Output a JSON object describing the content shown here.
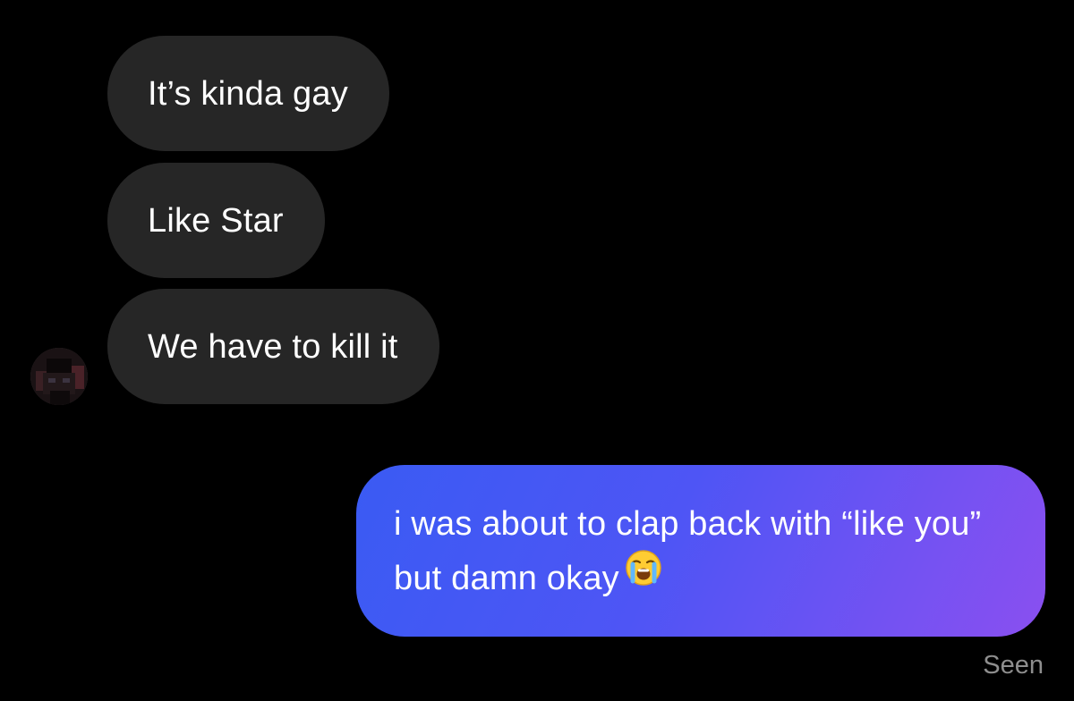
{
  "conversation": {
    "incoming_messages": [
      {
        "text": "It’s kinda gay"
      },
      {
        "text": "Like Star"
      },
      {
        "text": "We have to kill it"
      }
    ],
    "outgoing_message": {
      "text": "i was about to clap back with “like you” but damn okay",
      "emoji": "loudly-crying-face-icon"
    },
    "status": "Seen"
  },
  "colors": {
    "background": "#000000",
    "incoming_bubble": "#262626",
    "outgoing_gradient_start": "#3a5bf3",
    "outgoing_gradient_end": "#8a4ff0",
    "status_text": "#8e8e8e"
  }
}
